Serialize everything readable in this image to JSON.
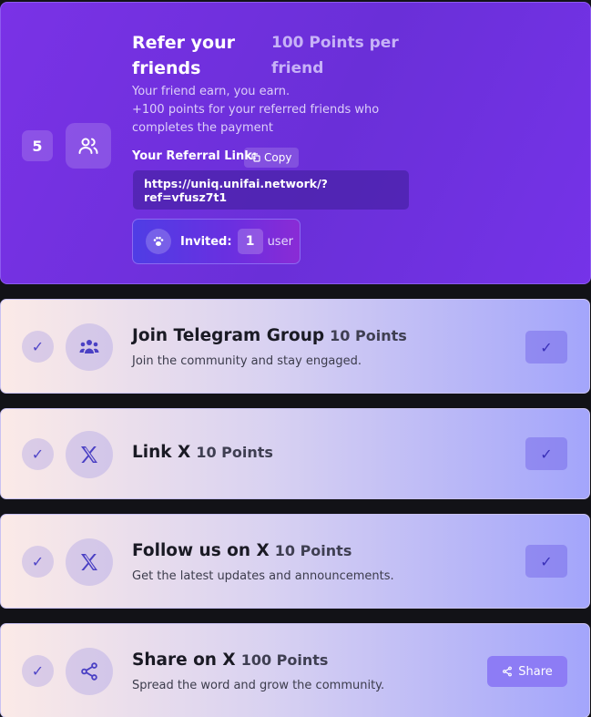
{
  "referral": {
    "step": "5",
    "title": "Refer your friends",
    "points": "100 Points per friend",
    "desc_line1": "Your friend earn, you earn.",
    "desc_line2": "+100 points for your referred friends who completes the payment",
    "link_label": "Your Referral Link:",
    "copy_label": "Copy",
    "link": "https://uniq.unifai.network/?ref=vfusz7t1",
    "invited_label": "Invited:",
    "invited_count": "1",
    "invited_unit": "user"
  },
  "tasks": [
    {
      "check": "✓",
      "name": "Join Telegram Group",
      "points": "10 Points",
      "desc": "Join the community and stay engaged.",
      "action": "✓"
    },
    {
      "check": "✓",
      "name": "Link X",
      "points": "10 Points",
      "desc": "",
      "action": "✓"
    },
    {
      "check": "✓",
      "name": "Follow us on X",
      "points": "10 Points",
      "desc": "Get the latest updates and announcements.",
      "action": "✓"
    },
    {
      "check": "✓",
      "name": "Share on X",
      "points": "100 Points",
      "desc": "Spread the word and grow the community.",
      "action": "Share"
    }
  ],
  "icons": {
    "referral": "users-icon",
    "telegram": "group-icon",
    "x": "x-logo-icon",
    "share": "share-icon",
    "copy": "copy-icon",
    "paw": "paw-icon"
  },
  "colors": {
    "accent": "#7a32e6",
    "button": "#8d7cf5",
    "check": "#5046c8"
  }
}
